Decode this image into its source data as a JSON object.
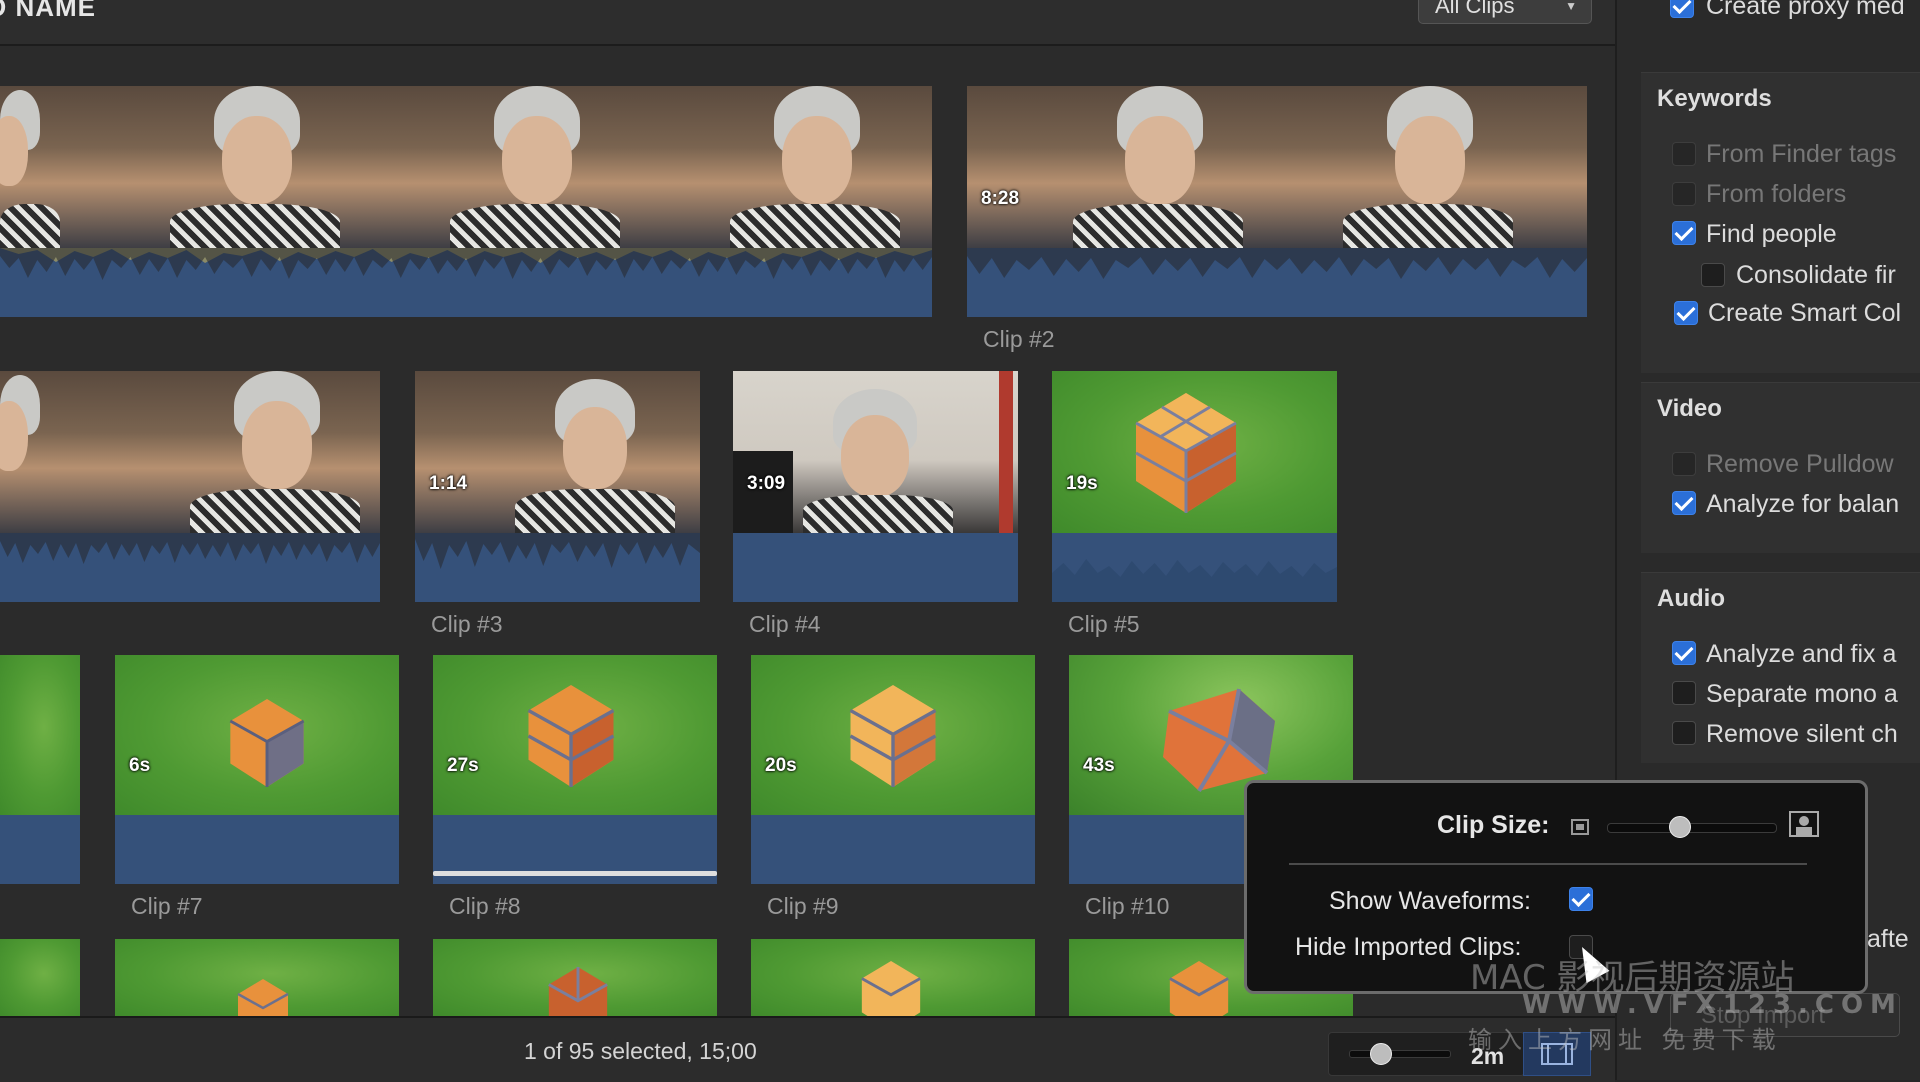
{
  "header": {
    "title": "O NAME",
    "filter": "All Clips"
  },
  "clips": [
    {
      "id": "clip-1",
      "label": "",
      "duration": ""
    },
    {
      "id": "clip-2",
      "label": "Clip #2",
      "duration": "8:28"
    },
    {
      "id": "clip-row2-first",
      "label": "",
      "duration": ""
    },
    {
      "id": "clip-3",
      "label": "Clip #3",
      "duration": "1:14"
    },
    {
      "id": "clip-4",
      "label": "Clip #4",
      "duration": "3:09"
    },
    {
      "id": "clip-5",
      "label": "Clip #5",
      "duration": "19s"
    },
    {
      "id": "clip-6",
      "label": "",
      "duration": ""
    },
    {
      "id": "clip-7",
      "label": "Clip #7",
      "duration": "6s"
    },
    {
      "id": "clip-8",
      "label": "Clip #8",
      "duration": "27s"
    },
    {
      "id": "clip-9",
      "label": "Clip #9",
      "duration": "20s"
    },
    {
      "id": "clip-10",
      "label": "Clip #10",
      "duration": "43s"
    }
  ],
  "inspector": {
    "top": {
      "label": "Create proxy med",
      "checked": true
    },
    "keywords": {
      "title": "Keywords",
      "items": [
        {
          "label": "From Finder tags",
          "checked": false,
          "enabled": false
        },
        {
          "label": "From folders",
          "checked": false,
          "enabled": false
        },
        {
          "label": "Find people",
          "checked": true,
          "enabled": true
        },
        {
          "label": "Consolidate fir",
          "checked": false,
          "enabled": true
        },
        {
          "label": "Create Smart Col",
          "checked": true,
          "enabled": true
        }
      ]
    },
    "video": {
      "title": "Video",
      "items": [
        {
          "label": "Remove Pulldow",
          "checked": false,
          "enabled": false
        },
        {
          "label": "Analyze for balan",
          "checked": true,
          "enabled": true
        }
      ]
    },
    "audio": {
      "title": "Audio",
      "items": [
        {
          "label": "Analyze and fix a",
          "checked": true,
          "enabled": true
        },
        {
          "label": "Separate mono a",
          "checked": false,
          "enabled": true
        },
        {
          "label": "Remove silent ch",
          "checked": false,
          "enabled": true
        }
      ]
    },
    "after_text": "afte",
    "stop_import": "Stop Import"
  },
  "popover": {
    "clip_size_label": "Clip Size:",
    "clip_size_level": 0.42,
    "show_waveforms_label": "Show Waveforms:",
    "show_waveforms": true,
    "hide_imported_label": "Hide Imported Clips:",
    "hide_imported": false
  },
  "status": {
    "selection": "1 of 95 selected, 15;00",
    "zoom_value": "2m",
    "zoom_level": 0.3
  },
  "watermark": {
    "line1": "MAC 影视后期资源站",
    "line2": "WWW.VFX123.COM",
    "line3": "输入上方网址 免费下载"
  }
}
